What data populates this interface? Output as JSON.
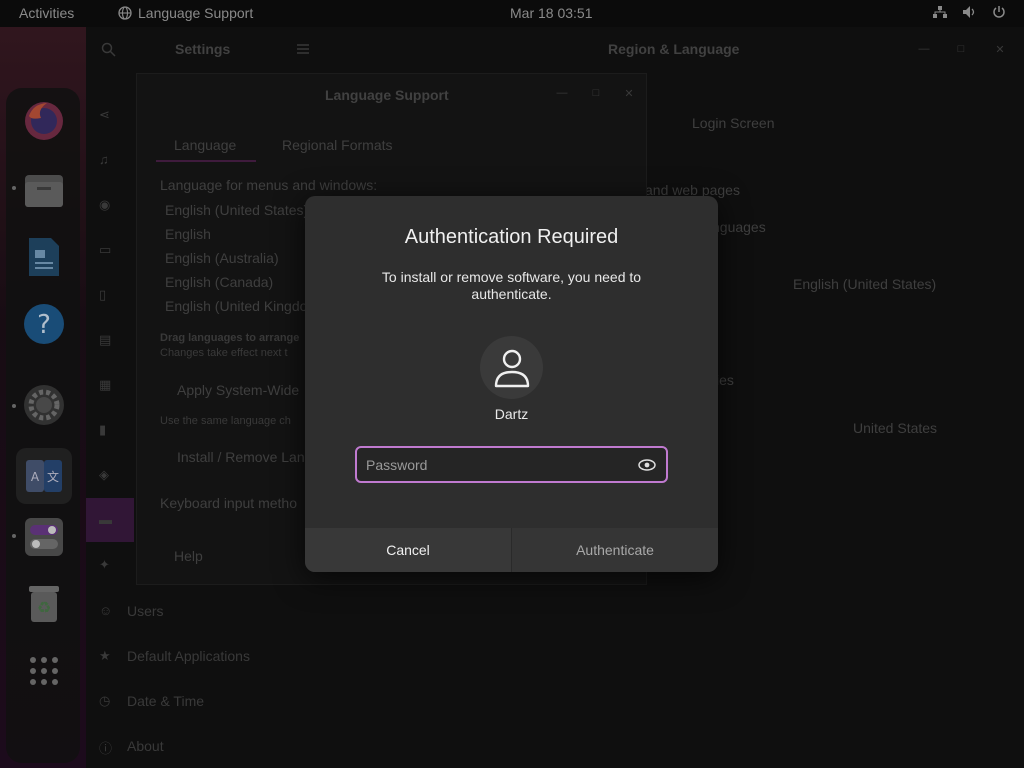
{
  "topbar": {
    "activities": "Activities",
    "app_name": "Language Support",
    "clock": "Mar 18  03:51"
  },
  "dock": {
    "items": [
      "firefox-icon",
      "files-icon",
      "writer-icon",
      "help-icon",
      "settings-icon",
      "language-icon",
      "tweaks-icon",
      "trash-icon",
      "app-grid-icon"
    ]
  },
  "settings": {
    "title": "Settings",
    "panel_title": "Region & Language",
    "sidebar": {
      "items": [
        "Users",
        "Default Applications",
        "Date & Time",
        "About"
      ]
    },
    "right": {
      "tab_login": "Login Screen",
      "and_web_pages": "and web pages",
      "nguages": "nguages",
      "language_value": "English (United States)",
      "ies": "ies",
      "formats_value": "United States"
    }
  },
  "language_support": {
    "title": "Language Support",
    "tabs": [
      "Language",
      "Regional Formats"
    ],
    "menus_label": "Language for menus and windows:",
    "languages": [
      "English (United States)",
      "English",
      "English (Australia)",
      "English (Canada)",
      "English (United Kingdom)"
    ],
    "drag_hint": "Drag languages to arrange",
    "changes_hint": "Changes take effect next t",
    "apply_button": "Apply System-Wide",
    "same_language_hint": "Use the same language ch",
    "install_button": "Install / Remove Lan",
    "keyboard_label": "Keyboard input metho",
    "help_button": "Help"
  },
  "auth_dialog": {
    "title": "Authentication Required",
    "message": "To install or remove software, you need to authenticate.",
    "username": "Dartz",
    "password_placeholder": "Password",
    "cancel_label": "Cancel",
    "authenticate_label": "Authenticate"
  },
  "colors": {
    "accent": "#c07ad0",
    "dialog_bg": "#2e2e2e"
  }
}
